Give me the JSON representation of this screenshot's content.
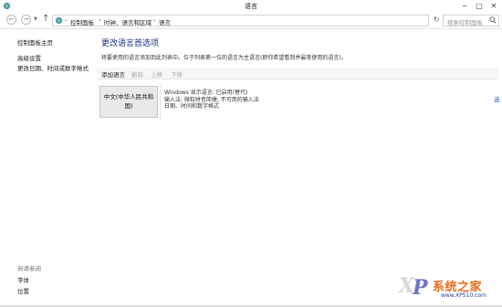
{
  "window": {
    "title": "语言",
    "minimize_glyph": "─",
    "maximize_glyph": "□",
    "close_glyph": "✕"
  },
  "nav": {
    "back_glyph": "←",
    "forward_glyph": "→",
    "dropdown_glyph": "▼",
    "up_glyph": "↑",
    "refresh_glyph": "↻"
  },
  "breadcrumb": {
    "items": [
      "控制面板",
      "时钟、语言和区域",
      "语言"
    ],
    "separator": "›"
  },
  "search": {
    "placeholder": "搜索控制面板",
    "icon": "search-icon"
  },
  "sidebar": {
    "home": "控制面板主页",
    "advanced": "高级设置",
    "date_format": "更改日期、时间或数字格式",
    "see_also": "另请参阅",
    "fonts": "字体",
    "location": "位置"
  },
  "main": {
    "title": "更改语言首选项",
    "description": "将要使用的语言添加到此列表中。位于列表第一位的语言为主语言(即你希望看到并最常使用的语言)。",
    "toolbar": {
      "add": "添加语言",
      "remove": "删除",
      "move_up": "上移",
      "move_down": "下移"
    },
    "languages": [
      {
        "name": "中文(中华人民共和国)",
        "info": [
          "Windows 显示语言: 已启用(替代)",
          "输入法: 微软拼音简捷, 不可用的输入法",
          "日期、时间和数字格式"
        ],
        "options_link": "选"
      }
    ]
  },
  "watermark": {
    "letter_x": "X",
    "letter_p": "P",
    "name": "系统之家",
    "url": "www.XP510.com"
  },
  "colors": {
    "title_blue": "#1e3287",
    "link_blue": "#1a62c5",
    "toolbar_bg": "#f5f6f7",
    "tile_bg": "#e9e9e9",
    "watermark_orange": "#e86b1a",
    "watermark_purple": "#6a74c9"
  }
}
